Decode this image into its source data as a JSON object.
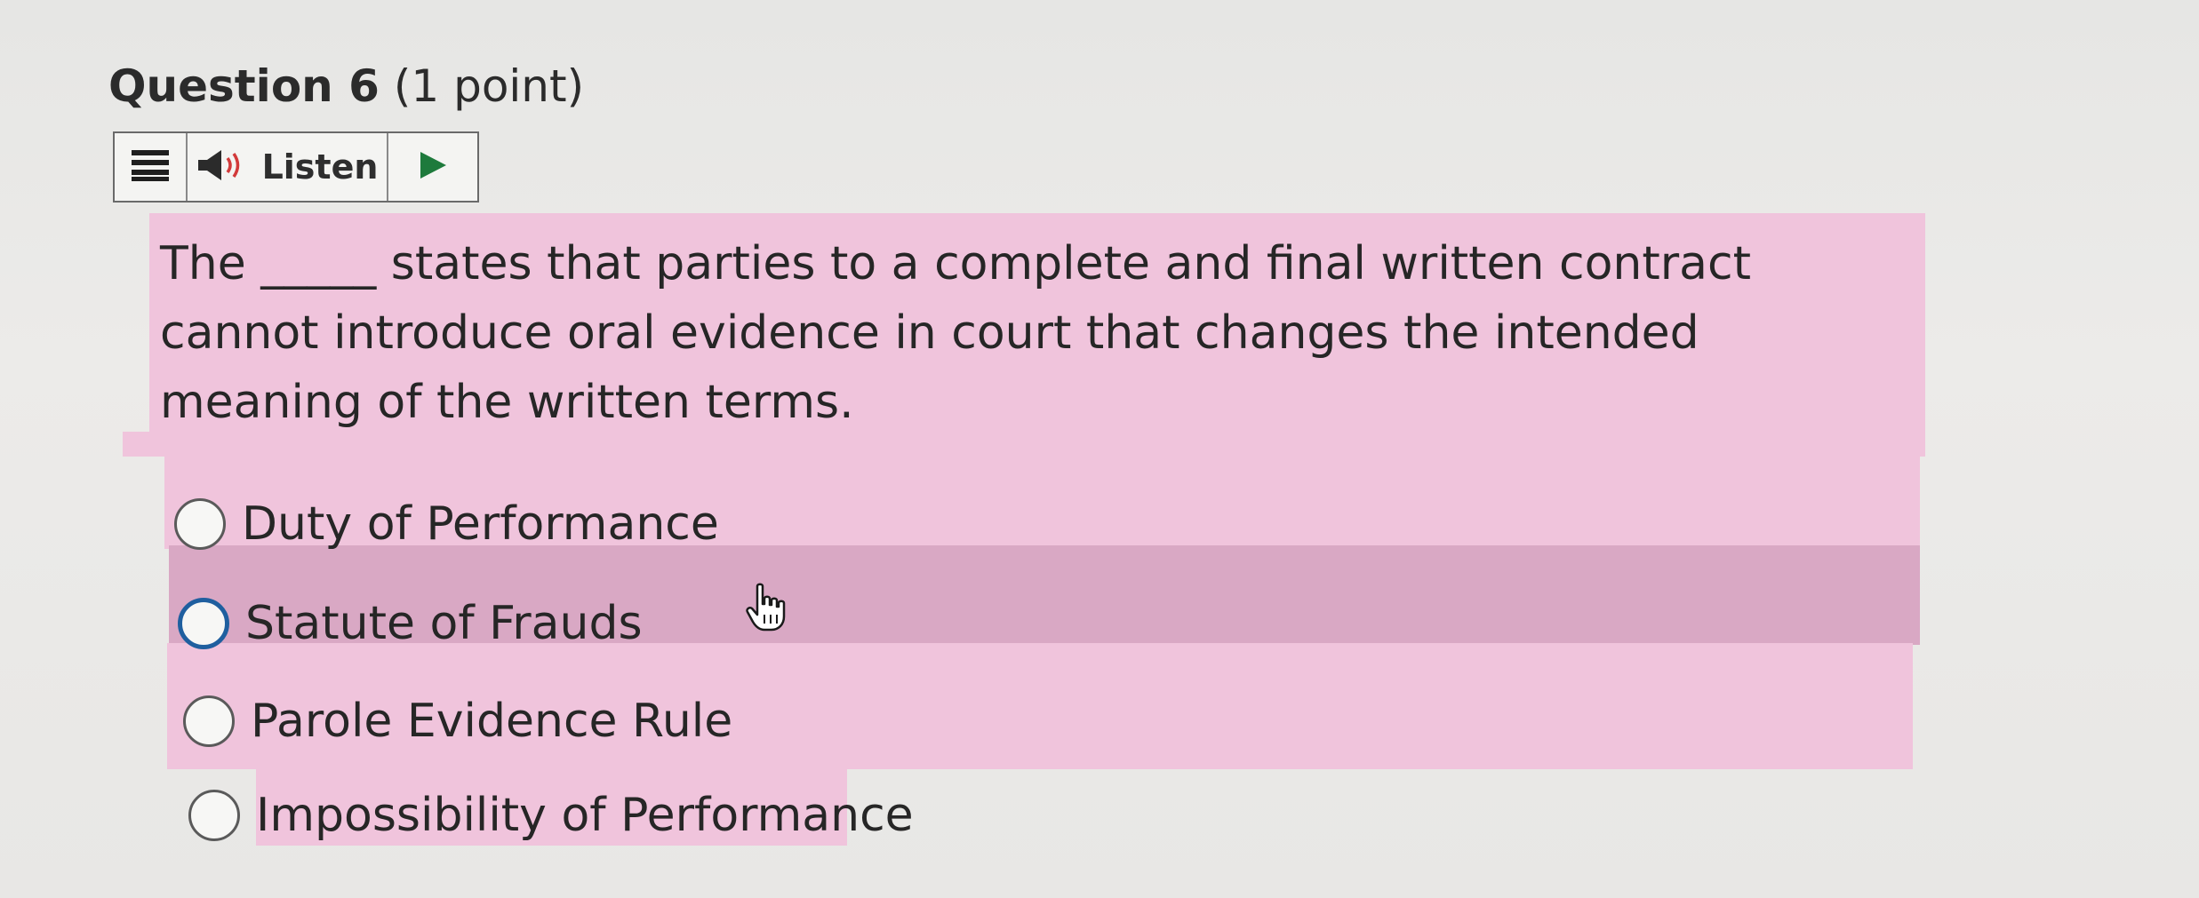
{
  "question": {
    "title": "Question 6",
    "points": "(1 point)",
    "text": "The _____ states that parties to a complete and final written contract cannot introduce oral evidence in court that changes the intended meaning of the written terms."
  },
  "listen_toolbar": {
    "menu_icon": "menu-lines-icon",
    "speaker_icon": "speaker-icon",
    "listen_label": "Listen",
    "play_icon": "play-triangle-icon",
    "play_color": "#1e7a3c"
  },
  "options": [
    {
      "label": "Duty of Performance",
      "selected": false
    },
    {
      "label": "Statute of Frauds",
      "selected": false,
      "focused": true
    },
    {
      "label": "Parole Evidence Rule",
      "selected": false
    },
    {
      "label": "Impossibility of Performance",
      "selected": false
    }
  ],
  "colors": {
    "highlight": "#f0c4dc",
    "hover_row": "#d9a8c4",
    "focus_ring": "#1f5f9f"
  },
  "cursor_icon": "hand-pointer-icon"
}
